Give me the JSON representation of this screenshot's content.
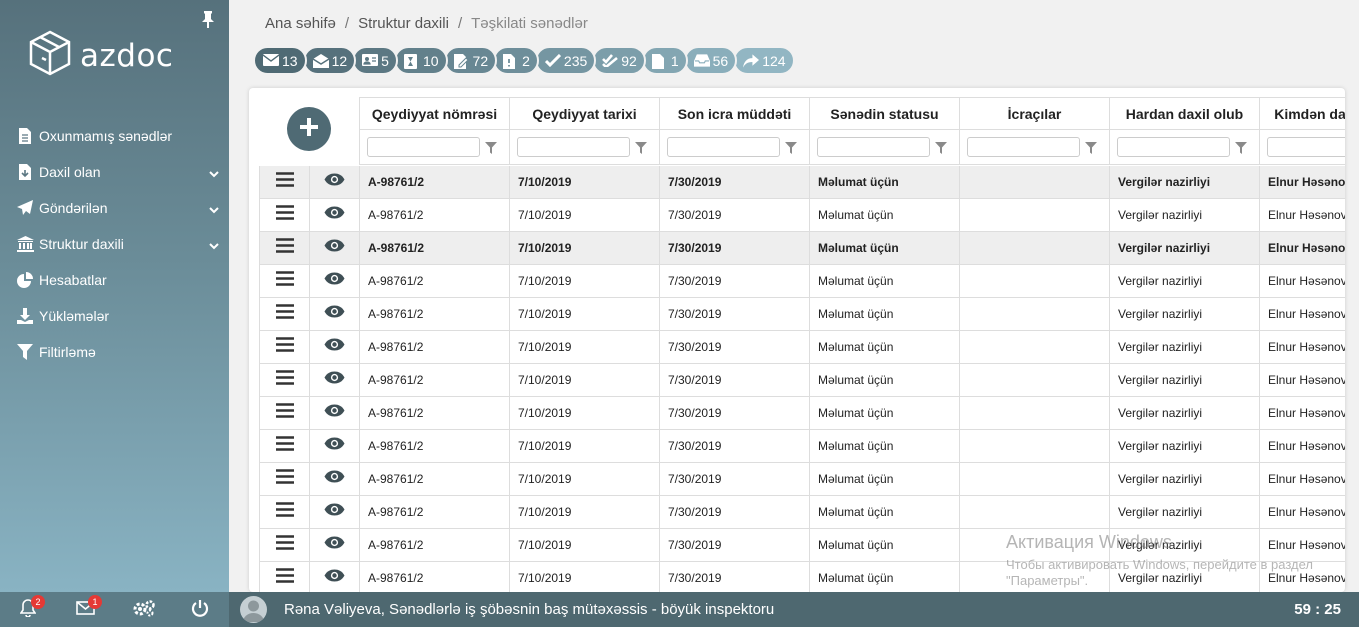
{
  "app": {
    "logo_text": "azdoc"
  },
  "sidebar": {
    "items": [
      {
        "label": "Oxunmamış sənədlər",
        "icon": "document-icon",
        "has_submenu": false
      },
      {
        "label": "Daxil olan",
        "icon": "inbox-download-icon",
        "has_submenu": true
      },
      {
        "label": "Göndərilən",
        "icon": "paper-plane-icon",
        "has_submenu": true
      },
      {
        "label": "Struktur daxili",
        "icon": "institution-icon",
        "has_submenu": true
      },
      {
        "label": "Hesabatlar",
        "icon": "pie-chart-icon",
        "has_submenu": false
      },
      {
        "label": "Yükləmələr",
        "icon": "download-icon",
        "has_submenu": false
      },
      {
        "label": "Filtirləmə",
        "icon": "filter-icon",
        "has_submenu": false
      }
    ]
  },
  "breadcrumb": {
    "home": "Ana səhifə",
    "section": "Struktur daxili",
    "current": "Təşkilati sənədlər",
    "separator": "/"
  },
  "counters": [
    {
      "count": "13",
      "icon": "envelope-icon",
      "color": "#4f6a74"
    },
    {
      "count": "12",
      "icon": "envelope-open-icon",
      "color": "#56717c"
    },
    {
      "count": "5",
      "icon": "id-card-icon",
      "color": "#5c7883"
    },
    {
      "count": "10",
      "icon": "hourglass-doc-icon",
      "color": "#62808b"
    },
    {
      "count": "72",
      "icon": "edit-doc-icon",
      "color": "#688793"
    },
    {
      "count": "2",
      "icon": "file-alert-icon",
      "color": "#6e8e9a"
    },
    {
      "count": "235",
      "icon": "check-icon",
      "color": "#7596a2"
    },
    {
      "count": "92",
      "icon": "double-check-icon",
      "color": "#7c9eaa"
    },
    {
      "count": "1",
      "icon": "file-icon",
      "color": "#83a6b2"
    },
    {
      "count": "56",
      "icon": "tray-icon",
      "color": "#8aaebb"
    },
    {
      "count": "124",
      "icon": "share-icon",
      "color": "#92b6c3"
    }
  ],
  "table": {
    "columns": [
      "Qeydiyyat nömrəsi",
      "Qeydiyyat tarixi",
      "Son icra müddəti",
      "Sənədin statusu",
      "İcraçılar",
      "Hardan daxil olub",
      "Kimdən daxil olub"
    ],
    "filter_placeholder": "",
    "rows": [
      [
        "A-98761/2",
        "7/10/2019",
        "7/30/2019",
        "Məlumat üçün",
        "",
        "Vergilər nazirliyi",
        "Elnur Həsənov"
      ],
      [
        "A-98761/2",
        "7/10/2019",
        "7/30/2019",
        "Məlumat üçün",
        "",
        "Vergilər nazirliyi",
        "Elnur Həsənov"
      ],
      [
        "A-98761/2",
        "7/10/2019",
        "7/30/2019",
        "Məlumat üçün",
        "",
        "Vergilər nazirliyi",
        "Elnur Həsənov"
      ],
      [
        "A-98761/2",
        "7/10/2019",
        "7/30/2019",
        "Məlumat üçün",
        "",
        "Vergilər nazirliyi",
        "Elnur Həsənov"
      ],
      [
        "A-98761/2",
        "7/10/2019",
        "7/30/2019",
        "Məlumat üçün",
        "",
        "Vergilər nazirliyi",
        "Elnur Həsənov"
      ],
      [
        "A-98761/2",
        "7/10/2019",
        "7/30/2019",
        "Məlumat üçün",
        "",
        "Vergilər nazirliyi",
        "Elnur Həsənov"
      ],
      [
        "A-98761/2",
        "7/10/2019",
        "7/30/2019",
        "Məlumat üçün",
        "",
        "Vergilər nazirliyi",
        "Elnur Həsənov"
      ],
      [
        "A-98761/2",
        "7/10/2019",
        "7/30/2019",
        "Məlumat üçün",
        "",
        "Vergilər nazirliyi",
        "Elnur Həsənov"
      ],
      [
        "A-98761/2",
        "7/10/2019",
        "7/30/2019",
        "Məlumat üçün",
        "",
        "Vergilər nazirliyi",
        "Elnur Həsənov"
      ],
      [
        "A-98761/2",
        "7/10/2019",
        "7/30/2019",
        "Məlumat üçün",
        "",
        "Vergilər nazirliyi",
        "Elnur Həsənov"
      ],
      [
        "A-98761/2",
        "7/10/2019",
        "7/30/2019",
        "Məlumat üçün",
        "",
        "Vergilər nazirliyi",
        "Elnur Həsənov"
      ],
      [
        "A-98761/2",
        "7/10/2019",
        "7/30/2019",
        "Məlumat üçün",
        "",
        "Vergilər nazirliyi",
        "Elnur Həsənov"
      ],
      [
        "A-98761/2",
        "7/10/2019",
        "7/30/2019",
        "Məlumat üçün",
        "",
        "Vergilər nazirliyi",
        "Elnur Həsənov"
      ]
    ],
    "highlighted_rows": [
      0,
      2
    ]
  },
  "bottombar": {
    "notifications_count": "2",
    "messages_count": "1",
    "user_text": "Rəna Vəliyeva, Sənədlərlə iş şöbəsnin baş mütəxəssis - böyük inspektoru",
    "timer": "59 : 25"
  },
  "watermark": {
    "title": "Активация Windows",
    "subtitle": "Чтобы активировать Windows, перейдите в раздел \"Параметры\"."
  }
}
